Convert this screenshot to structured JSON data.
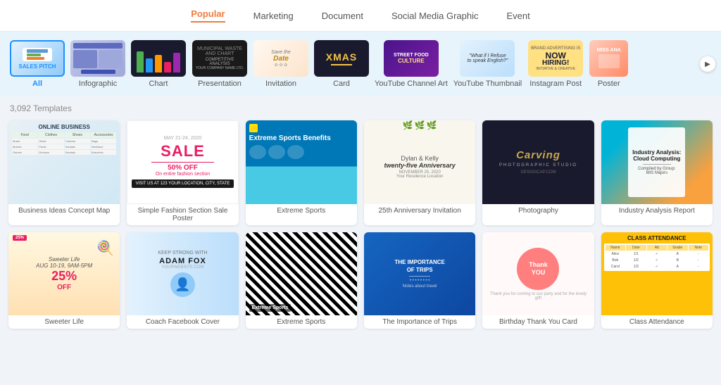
{
  "nav": {
    "tabs": [
      {
        "label": "Popular",
        "active": true
      },
      {
        "label": "Marketing",
        "active": false
      },
      {
        "label": "Document",
        "active": false
      },
      {
        "label": "Social Media Graphic",
        "active": false
      },
      {
        "label": "Event",
        "active": false
      }
    ]
  },
  "categories": [
    {
      "label": "All",
      "selected": true,
      "type": "all"
    },
    {
      "label": "Infographic",
      "selected": false,
      "type": "infographic"
    },
    {
      "label": "Chart",
      "selected": false,
      "type": "chart"
    },
    {
      "label": "Presentation",
      "selected": false,
      "type": "presentation"
    },
    {
      "label": "Invitation",
      "selected": false,
      "type": "invitation"
    },
    {
      "label": "Card",
      "selected": false,
      "type": "card"
    },
    {
      "label": "YouTube Channel Art",
      "selected": false,
      "type": "youtube"
    },
    {
      "label": "YouTube Thumbnail",
      "selected": false,
      "type": "thumbnail"
    },
    {
      "label": "Instagram Post",
      "selected": false,
      "type": "instagram"
    },
    {
      "label": "Poster",
      "selected": false,
      "type": "poster"
    }
  ],
  "grid_header": "3,092 Templates",
  "templates": [
    {
      "label": "Business Ideas Concept Map",
      "row": 1,
      "col": 1
    },
    {
      "label": "Simple Fashion Section Sale Poster",
      "row": 1,
      "col": 2
    },
    {
      "label": "Extreme Sports",
      "row": 1,
      "col": 3
    },
    {
      "label": "25th Anniversary Invitation",
      "row": 1,
      "col": 4
    },
    {
      "label": "Photography",
      "row": 1,
      "col": 5
    },
    {
      "label": "Industry Analysis Report",
      "row": 1,
      "col": 6
    },
    {
      "label": "Sweeter Life",
      "row": 2,
      "col": 1
    },
    {
      "label": "Coach Facebook Cover",
      "row": 2,
      "col": 2
    },
    {
      "label": "Extreme Sports",
      "row": 2,
      "col": 3
    },
    {
      "label": "The Importance of Trips",
      "row": 2,
      "col": 4
    },
    {
      "label": "Birthday Thank You Card",
      "row": 2,
      "col": 5
    },
    {
      "label": "Class Attendance",
      "row": 2,
      "col": 6
    }
  ],
  "carving": {
    "title": "Carving",
    "subtitle": "PHOTOGRAPHIC STUDIO"
  },
  "anniversary": {
    "names": "Dylan & Kelly",
    "subtitle": "twenty-five Anniversary",
    "date": "NOVEMBER 25, 2020",
    "location": "Your Residence Location"
  },
  "industry": {
    "title": "Industry Analysis:",
    "subtitle": "Cloud Computing",
    "compiled": "Compiled by Group:",
    "group": "MIS Majors"
  },
  "sale": {
    "date": "MAY 21-24, 2020",
    "text": "SALE",
    "percent": "50% OFF",
    "sub": "On entire fashion section"
  },
  "extreme": {
    "title": "Extreme Sports Benefits"
  },
  "online_biz": {
    "title": "ONLINE BUSINESS"
  }
}
